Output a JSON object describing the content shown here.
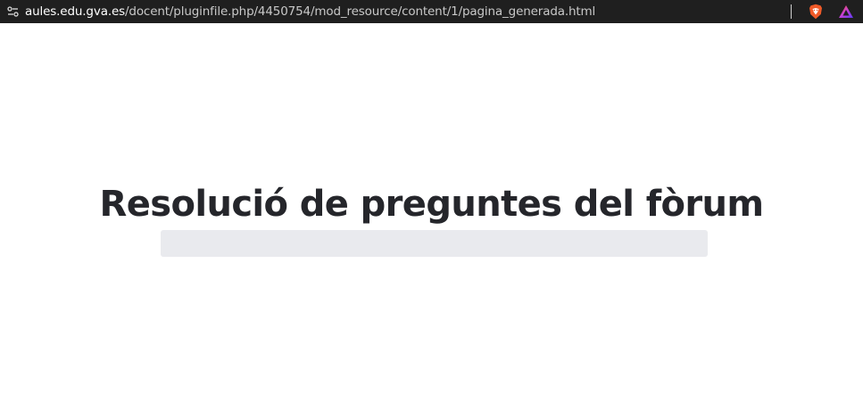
{
  "browser": {
    "url_host": "aules.edu.gva.es",
    "url_path": "/docent/pluginfile.php/4450754/mod_resource/content/1/pagina_generada.html",
    "icons": {
      "site_info": "site-info-tune-icon",
      "brave": "brave-lion-icon",
      "extension": "aurora-triangle-icon"
    }
  },
  "page": {
    "title": "Resolució de preguntes del fòrum"
  }
}
